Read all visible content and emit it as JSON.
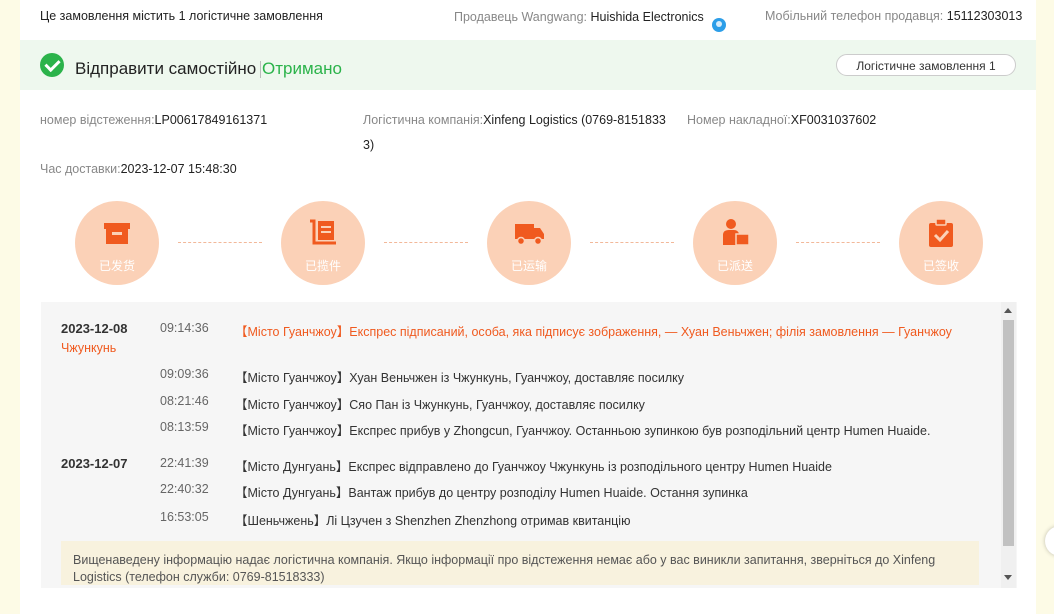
{
  "header": {
    "order_info": "Це замовлення містить 1 логістичне замовлення",
    "seller_wangwang_label": "Продавець Wangwang:",
    "seller_name": "Huishida Electronics",
    "seller_phone_label": "Мобільний телефон продавця:",
    "seller_phone": "15112303013"
  },
  "status": {
    "title": "Відправити самостійно",
    "badge": "Отримано",
    "logistics_order_button": "Логістичне замовлення 1",
    "accent_color": "#2bb34a"
  },
  "details": {
    "tracking_label": "номер відстеження:",
    "tracking_value": "LP00617849161371",
    "company_label": "Логістична компанія:",
    "company_value_line1": "Xinfeng Logistics (0769-8151833",
    "company_value_line2": "3)",
    "waybill_label": "Номер накладної:",
    "waybill_value": "XF0031037602",
    "delivery_time_label": "Час доставки:",
    "delivery_time_value": "2023-12-07 15:48:30"
  },
  "steps": [
    {
      "label": "已发货",
      "icon": "box-icon"
    },
    {
      "label": "已揽件",
      "icon": "package-cart-icon"
    },
    {
      "label": "已运输",
      "icon": "truck-icon"
    },
    {
      "label": "已派送",
      "icon": "courier-icon"
    },
    {
      "label": "已签收",
      "icon": "signed-clipboard-icon"
    }
  ],
  "tracking": {
    "groups": [
      {
        "date": "2023-12-08",
        "date_suffix": "Чжункунь",
        "events": [
          {
            "time": "09:14:36",
            "text": "【Місто Гуанчжоу】Експрес підписаний, особа, яка підписує зображення, — Хуан Веньчжен; філія замовлення — Гуанчжоу",
            "highlight": true
          },
          {
            "time": "09:09:36",
            "text": "【Місто Гуанчжоу】Хуан Веньчжен із Чжункунь, Гуанчжоу, доставляє посилку"
          },
          {
            "time": "08:21:46",
            "text": "【Місто Гуанчжоу】Сяо Пан із Чжункунь, Гуанчжоу, доставляє посилку"
          },
          {
            "time": "08:13:59",
            "text": "【Місто Гуанчжоу】Експрес прибув у Zhongcun, Гуанчжоу. Останньою зупинкою був розподільний центр Humen Huaide."
          }
        ]
      },
      {
        "date": "2023-12-07",
        "events": [
          {
            "time": "22:41:39",
            "text": "【Місто Дунгуань】Експрес відправлено до Гуанчжоу Чжункунь із розподільного центру Humen Huaide"
          },
          {
            "time": "22:40:32",
            "text": "【Місто Дунгуань】Вантаж прибув до центру розподілу Humen Huaide. Остання зупинка"
          },
          {
            "time": "16:53:05",
            "text": "【Шеньчжень】Лі Цзучен з Shenzhen Zhenzhong отримав квитанцію"
          }
        ]
      }
    ],
    "highlight_color": "#f05a1f",
    "notice": "Вищенаведену інформацію надає логістична компанія. Якщо інформації про відстеження немає або у вас виникли запитання, зверніться до Xinfeng Logistics (телефон служби: 0769-81518333)"
  }
}
